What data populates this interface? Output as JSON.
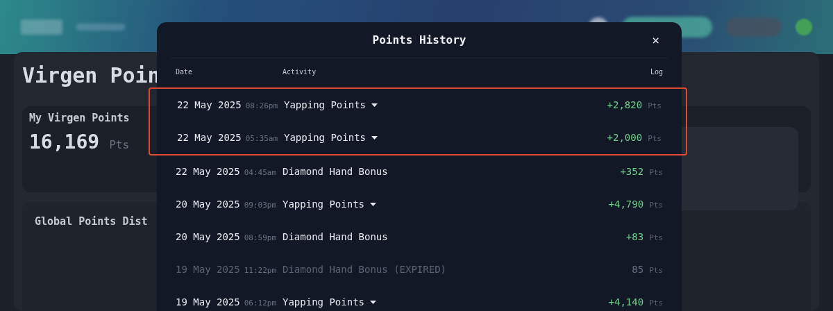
{
  "background": {
    "heading": "Virgen Poin",
    "card_title": "My Virgen Points",
    "balance": "16,169",
    "balance_unit": "Pts",
    "section_title": "Global Points Dist"
  },
  "modal": {
    "title": "Points History",
    "close": "×",
    "columns": [
      "Date",
      "Activity",
      "Log"
    ],
    "rows": [
      {
        "date": "22 May 2025",
        "time": "08:26pm",
        "activity": "Yapping Points",
        "expandable": true,
        "amount": "+2,820",
        "unit": "Pts",
        "expired": false,
        "highlighted": true
      },
      {
        "date": "22 May 2025",
        "time": "05:35am",
        "activity": "Yapping Points",
        "expandable": true,
        "amount": "+2,000",
        "unit": "Pts",
        "expired": false,
        "highlighted": true
      },
      {
        "date": "22 May 2025",
        "time": "04:45am",
        "activity": "Diamond Hand Bonus",
        "expandable": false,
        "amount": "+352",
        "unit": "Pts",
        "expired": false,
        "highlighted": false
      },
      {
        "date": "20 May 2025",
        "time": "09:03pm",
        "activity": "Yapping Points",
        "expandable": true,
        "amount": "+4,790",
        "unit": "Pts",
        "expired": false,
        "highlighted": false
      },
      {
        "date": "20 May 2025",
        "time": "08:59pm",
        "activity": "Diamond Hand Bonus",
        "expandable": false,
        "amount": "+83",
        "unit": "Pts",
        "expired": false,
        "highlighted": false
      },
      {
        "date": "19 May 2025",
        "time": "11:22pm",
        "activity": "Diamond Hand Bonus (EXPIRED)",
        "expandable": false,
        "amount": "85",
        "unit": "Pts",
        "expired": true,
        "highlighted": false
      },
      {
        "date": "19 May 2025",
        "time": "06:12pm",
        "activity": "Yapping Points",
        "expandable": true,
        "amount": "+4,140",
        "unit": "Pts",
        "expired": false,
        "highlighted": false
      }
    ]
  }
}
